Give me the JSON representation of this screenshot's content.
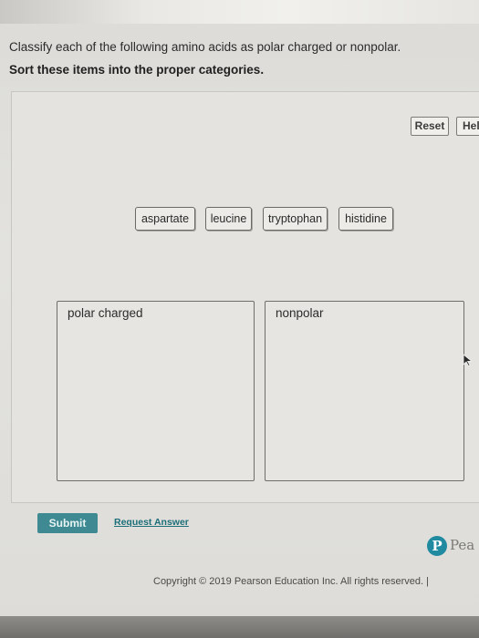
{
  "instructions": {
    "question": "Classify each of the following amino acids as polar charged or nonpolar.",
    "sort_prompt": "Sort these items into the proper categories."
  },
  "controls": {
    "reset_label": "Reset",
    "help_label": "Hel"
  },
  "items": [
    {
      "label": "aspartate"
    },
    {
      "label": "leucine"
    },
    {
      "label": "tryptophan"
    },
    {
      "label": "histidine"
    }
  ],
  "bins": [
    {
      "label": "polar charged"
    },
    {
      "label": "nonpolar"
    }
  ],
  "footer": {
    "submit_label": "Submit",
    "request_answer_label": "Request Answer",
    "brand_mark": "P",
    "brand_name": "Pea",
    "copyright": "Copyright © 2019 Pearson Education Inc. All rights reserved. |"
  },
  "colors": {
    "submit_bg": "#3f8a92",
    "link": "#1c6e79",
    "brand": "#1f8aa0"
  }
}
